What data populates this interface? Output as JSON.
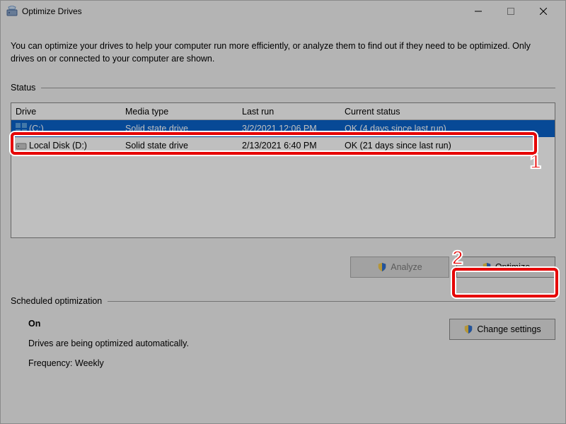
{
  "title": "Optimize Drives",
  "description": "You can optimize your drives to help your computer run more efficiently, or analyze them to find out if they need to be optimized. Only drives on or connected to your computer are shown.",
  "status_label": "Status",
  "columns": {
    "drive": "Drive",
    "media": "Media type",
    "last": "Last run",
    "status": "Current status"
  },
  "rows": [
    {
      "drive": "(C:)",
      "media": "Solid state drive",
      "last": "3/2/2021 12:06 PM",
      "status": "OK (4 days since last run)"
    },
    {
      "drive": "Local Disk (D:)",
      "media": "Solid state drive",
      "last": "2/13/2021 6:40 PM",
      "status": "OK (21 days since last run)"
    }
  ],
  "buttons": {
    "analyze": "Analyze",
    "optimize": "Optimize",
    "change": "Change settings"
  },
  "sched": {
    "label": "Scheduled optimization",
    "on": "On",
    "desc": "Drives are being optimized automatically.",
    "freq": "Frequency: Weekly"
  },
  "callouts": {
    "one": "1",
    "two": "2"
  }
}
